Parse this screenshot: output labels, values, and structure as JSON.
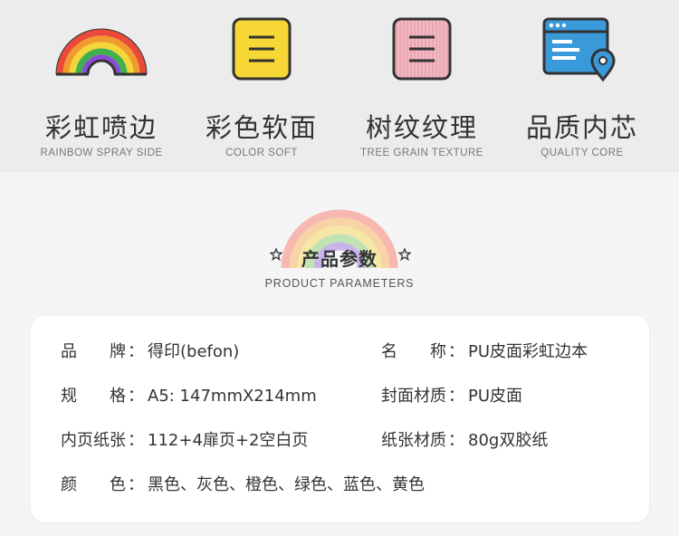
{
  "features": [
    {
      "cn": "彩虹喷边",
      "en": "RAINBOW SPRAY SIDE",
      "icon": "rainbow-icon"
    },
    {
      "cn": "彩色软面",
      "en": "COLOR SOFT",
      "icon": "yellow-notebook-icon"
    },
    {
      "cn": "树纹纹理",
      "en": "TREE GRAIN TEXTURE",
      "icon": "pink-notebook-icon"
    },
    {
      "cn": "品质内芯",
      "en": "QUALITY CORE",
      "icon": "browser-location-icon"
    }
  ],
  "params_title": {
    "cn": "产品参数",
    "en": "PRODUCT PARAMETERS"
  },
  "params": {
    "brand": {
      "label": "品　　牌",
      "value": "得印(befon)"
    },
    "name": {
      "label": "名　　称",
      "value": "PU皮面彩虹边本"
    },
    "spec": {
      "label": "规　　格",
      "value": "A5: 147mmX214mm"
    },
    "cover": {
      "label": "封面材质",
      "value": "PU皮面"
    },
    "pages": {
      "label": "内页纸张",
      "value": "112+4扉页+2空白页"
    },
    "paper": {
      "label": "纸张材质",
      "value": "80g双胶纸"
    },
    "color": {
      "label": "颜　　色",
      "value": "黑色、灰色、橙色、绿色、蓝色、黄色"
    }
  },
  "colon": "："
}
